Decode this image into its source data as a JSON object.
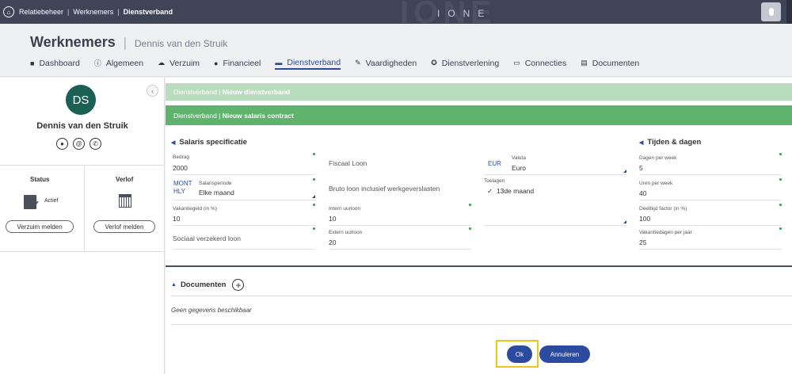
{
  "topbar": {
    "breadcrumbs": [
      "Relatiebeheer",
      "Werknemers",
      "Dienstverband"
    ],
    "brand": "IONE"
  },
  "header": {
    "title": "Werknemers",
    "subtitle": "Dennis van den Struik",
    "tabs": [
      {
        "label": "Dashboard",
        "icon": "dashboard-icon",
        "glyph": "■"
      },
      {
        "label": "Algemeen",
        "icon": "info-icon",
        "glyph": "ⓘ"
      },
      {
        "label": "Verzuim",
        "icon": "sick-icon",
        "glyph": "☁"
      },
      {
        "label": "Financieel",
        "icon": "finance-icon",
        "glyph": "●"
      },
      {
        "label": "Dienstverband",
        "icon": "briefcase-icon",
        "glyph": "▬",
        "active": true
      },
      {
        "label": "Vaardigheden",
        "icon": "skills-icon",
        "glyph": "✎"
      },
      {
        "label": "Dienstverlening",
        "icon": "service-icon",
        "glyph": "✪"
      },
      {
        "label": "Connecties",
        "icon": "connections-icon",
        "glyph": "▭"
      },
      {
        "label": "Documenten",
        "icon": "documents-icon",
        "glyph": "▤"
      }
    ]
  },
  "sidebar": {
    "initials": "DS",
    "name": "Dennis van den Struik",
    "status_title": "Status",
    "status_value": "Actief",
    "leave_title": "Verlof",
    "report_sick_button": "Verzuim melden",
    "report_leave_button": "Verlof melden"
  },
  "main": {
    "bar1_prefix": "Dienstverband",
    "bar1_title": "Nieuw dienstverband",
    "bar2_prefix": "Dienstverband",
    "bar2_title": "Nieuw salaris contract",
    "salary_section": "Salaris specificatie",
    "time_section": "Tijden & dagen",
    "fields": {
      "bedrag_label": "Bedrag",
      "bedrag_value": "2000",
      "salarisperiode_code1": "MONT",
      "salarisperiode_code2": "HLY",
      "salarisperiode_label": "Salarisperiode",
      "salarisperiode_value": "Elke maand",
      "vakantiegeld_label": "Vakantiegeld (in %)",
      "vakantiegeld_value": "10",
      "sociaal_label": "Sociaal verzekerd loon",
      "fiscaal_label": "Fiscaal Loon",
      "bruto_label": "Bruto loon inclusief werkgeverslasten",
      "intern_label": "Intern uurloon",
      "intern_value": "10",
      "extern_label": "Extern uurloon",
      "extern_value": "20",
      "valuta_code": "EUR",
      "valuta_label": "Valuta",
      "valuta_value": "Euro",
      "toelagen_label": "Toelagen",
      "toelagen_item": "13de maand",
      "dagen_label": "Dagen per week",
      "dagen_value": "5",
      "uren_label": "Uren per week",
      "uren_value": "40",
      "deelbijd_label": "Deelbijd factor (in %)",
      "deelbijd_value": "100",
      "vakantiedagen_label": "Vakantiedagen per jaar",
      "vakantiedagen_value": "25"
    },
    "documents_title": "Documenten",
    "empty_text": "Geen gegevens beschikbaar",
    "ok_button": "Ok",
    "cancel_button": "Annuleren"
  },
  "colors": {
    "topbar": "#3f4456",
    "accent": "#2c4a9e",
    "green_light": "#b9dcbf",
    "green": "#5fb36d",
    "avatar": "#1b5f55",
    "highlight": "#f0c419"
  }
}
